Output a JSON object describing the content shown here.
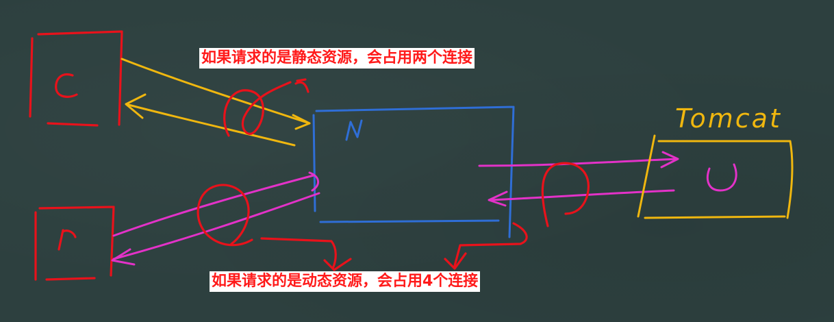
{
  "labels": {
    "client_top": "C",
    "client_bottom": "C",
    "nginx": "N",
    "tomcat_title": "Tomcat",
    "tomcat_inner": "U"
  },
  "captions": {
    "static": "如果请求的是静态资源，会占用两个连接",
    "dynamic": "如果请求的是动态资源，会占用4个连接"
  },
  "colors": {
    "board": "#2d403f",
    "client": "#e8121b",
    "static_link": "#f0b70f",
    "nginx": "#2f6ed6",
    "dynamic_link": "#e332c8",
    "tomcat": "#f0b70f",
    "caption_text": "#ff1a1a",
    "caption_bg": "#ffffff"
  }
}
